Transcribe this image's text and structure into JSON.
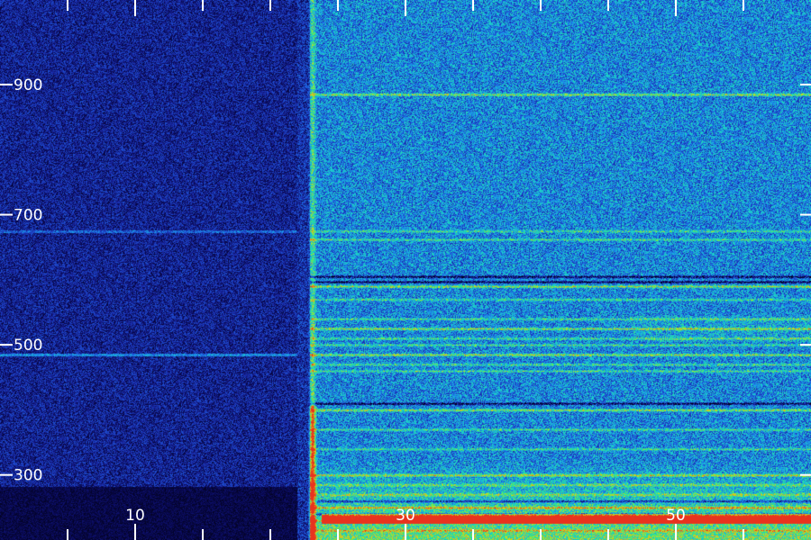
{
  "chart_data": {
    "type": "heatmap",
    "title": "",
    "xlabel": "",
    "ylabel": "",
    "x_ticks": [
      {
        "value": 10,
        "label": "10"
      },
      {
        "value": 30,
        "label": "30"
      },
      {
        "value": 50,
        "label": "50"
      }
    ],
    "x_minor_ticks": [
      5,
      15,
      20,
      25,
      35,
      40,
      45,
      55
    ],
    "xlim": [
      0,
      60
    ],
    "y_ticks": [
      {
        "value": 900,
        "label": "900"
      },
      {
        "value": 700,
        "label": "700"
      },
      {
        "value": 500,
        "label": "500"
      },
      {
        "value": 300,
        "label": "300"
      }
    ],
    "ylim": [
      200,
      1030
    ],
    "event_onset_x": 23.1,
    "quiet_interval_x": [
      0,
      22
    ],
    "emission_lines_y": [
      885,
      675,
      662,
      590,
      570,
      540,
      525,
      510,
      500,
      485,
      470,
      460,
      400,
      370,
      340,
      300,
      285,
      270,
      250,
      230,
      215
    ],
    "absorption_lines_y": [
      605,
      597,
      410,
      260,
      240
    ],
    "colormap": [
      "#000010",
      "#0a0a5a",
      "#1a2aa8",
      "#1e5adc",
      "#1a9ae8",
      "#1ad2c8",
      "#3ae87a",
      "#c8e01e",
      "#e89a1e",
      "#e8321e"
    ]
  }
}
